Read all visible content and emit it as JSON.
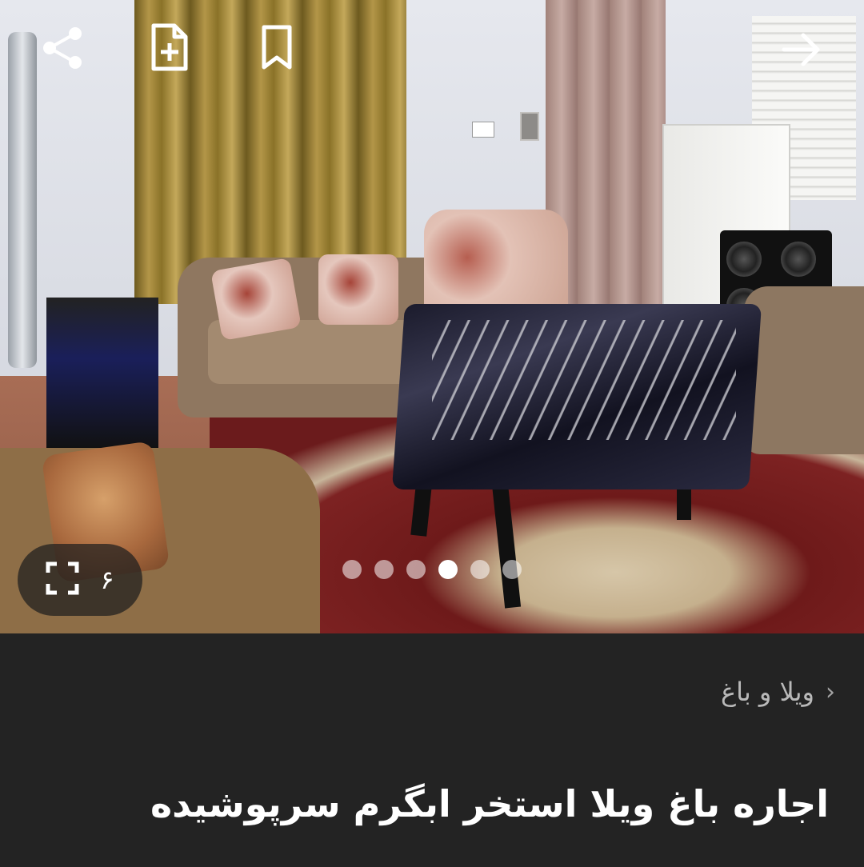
{
  "gallery": {
    "image_count": "۶",
    "slide_total": 6,
    "slide_active_index": 3,
    "icons": {
      "share": "share-icon",
      "note": "add-note-icon",
      "bookmark": "bookmark-icon",
      "back": "arrow-right-icon",
      "fullscreen": "fullscreen-icon"
    }
  },
  "breadcrumb": {
    "category": "ویلا و باغ"
  },
  "listing": {
    "title": "اجاره باغ ویلا استخر ابگرم سرپوشیده"
  },
  "colors": {
    "background": "#232323",
    "title_text": "#ffffff",
    "breadcrumb_text": "#b9b9b9"
  }
}
